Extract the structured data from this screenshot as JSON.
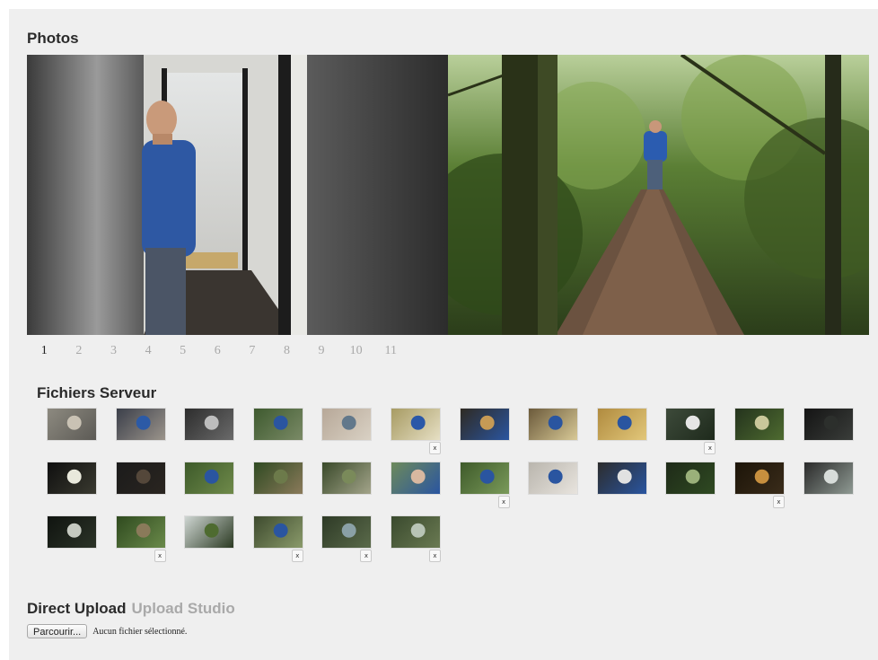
{
  "photos": {
    "heading": "Photos",
    "pager": [
      "1",
      "2",
      "3",
      "4",
      "5",
      "6",
      "7",
      "8",
      "9",
      "10",
      "11"
    ],
    "active_page": "1"
  },
  "server_files": {
    "heading": "Fichiers Serveur",
    "delete_label": "x",
    "rows": [
      [
        {
          "tone": [
            "#8d8a80",
            "#c9c2b4",
            "#5c5a55"
          ],
          "x": false
        },
        {
          "tone": [
            "#3b3f4a",
            "#2c5aa6",
            "#9b948b"
          ],
          "x": false
        },
        {
          "tone": [
            "#2d2d2d",
            "#bdbdbd",
            "#6a6a6a"
          ],
          "x": false
        },
        {
          "tone": [
            "#3e5a2f",
            "#2a55a0",
            "#7a8a66"
          ],
          "x": false
        },
        {
          "tone": [
            "#b7a898",
            "#62788b",
            "#d9d1c4"
          ],
          "x": false
        },
        {
          "tone": [
            "#a79b63",
            "#2a58a8",
            "#e6dfc4"
          ],
          "x": true
        },
        {
          "tone": [
            "#2f2a22",
            "#c69a55",
            "#2a55a0"
          ],
          "x": false
        },
        {
          "tone": [
            "#6b5a3b",
            "#2a55a0",
            "#d8c996"
          ],
          "x": false
        },
        {
          "tone": [
            "#b08b3f",
            "#2a55a0",
            "#e2c77a"
          ],
          "x": false
        },
        {
          "tone": [
            "#3d4a3a",
            "#e5e5e5",
            "#1e2a1c"
          ],
          "x": true
        },
        {
          "tone": [
            "#24331d",
            "#c9c79a",
            "#4e6b30"
          ],
          "x": false
        },
        {
          "tone": [
            "#141414",
            "#2c2f2c",
            "#3a3d3a"
          ],
          "x": false
        }
      ],
      [
        {
          "tone": [
            "#0f0f0f",
            "#e9e9dc",
            "#3a3a30"
          ],
          "x": false
        },
        {
          "tone": [
            "#1b1b1b",
            "#54473a",
            "#2a2520"
          ],
          "x": false
        },
        {
          "tone": [
            "#3d5a2a",
            "#2a55a0",
            "#6f8a4a"
          ],
          "x": false
        },
        {
          "tone": [
            "#2f4a22",
            "#6c7a4a",
            "#8a7a5a"
          ],
          "x": false
        },
        {
          "tone": [
            "#3a4a2a",
            "#7a8a5a",
            "#a3a48a"
          ],
          "x": false
        },
        {
          "tone": [
            "#6d8a5a",
            "#d8b8a0",
            "#2a55a0"
          ],
          "x": false
        },
        {
          "tone": [
            "#3e5a2a",
            "#2a55a0",
            "#7a9a5a"
          ],
          "x": true
        },
        {
          "tone": [
            "#b9b5ad",
            "#2a55a0",
            "#e8e4de"
          ],
          "x": false
        },
        {
          "tone": [
            "#2c2c2c",
            "#e1e1e1",
            "#2a55a0"
          ],
          "x": false
        },
        {
          "tone": [
            "#1e2a18",
            "#9ab07a",
            "#2f4a22"
          ],
          "x": false
        },
        {
          "tone": [
            "#1c1408",
            "#c78f3e",
            "#3a2c1a"
          ],
          "x": true
        },
        {
          "tone": [
            "#2a2a2a",
            "#d7dcd9",
            "#8f9a93"
          ],
          "x": false
        }
      ],
      [
        {
          "tone": [
            "#101410",
            "#c5c9c0",
            "#2b3327"
          ],
          "x": false
        },
        {
          "tone": [
            "#2f4a1f",
            "#8a7a5a",
            "#6a8a4a"
          ],
          "x": true
        },
        {
          "tone": [
            "#cfd6d3",
            "#4e6b30",
            "#2b3a22"
          ],
          "x": false
        },
        {
          "tone": [
            "#3d4a2e",
            "#2a55a0",
            "#8a9a6a"
          ],
          "x": true
        },
        {
          "tone": [
            "#2e3a26",
            "#8aa0a6",
            "#5a6a4a"
          ],
          "x": true
        },
        {
          "tone": [
            "#3a4a2e",
            "#b8c4b6",
            "#6a7a52"
          ],
          "x": true
        }
      ]
    ]
  },
  "upload": {
    "title": "Direct Upload",
    "studio_link": "Upload Studio",
    "browse_button": "Parcourir...",
    "file_status": "Aucun fichier sélectionné."
  }
}
